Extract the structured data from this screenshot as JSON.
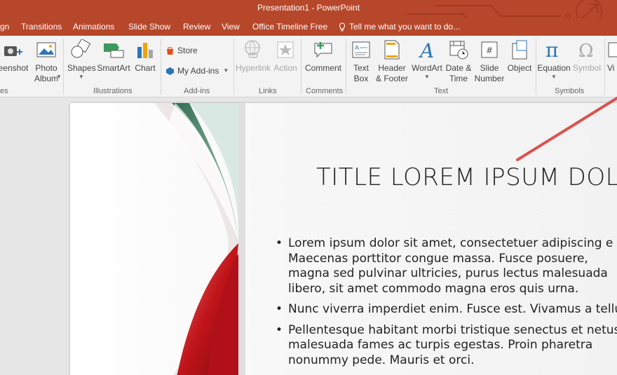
{
  "app": {
    "window_title": "Presentation1 - PowerPoint"
  },
  "tabs": [
    {
      "label": "gn"
    },
    {
      "label": "Transitions"
    },
    {
      "label": "Animations"
    },
    {
      "label": "Slide Show"
    },
    {
      "label": "Review"
    },
    {
      "label": "View"
    },
    {
      "label": "Office Timeline Free"
    }
  ],
  "tell_me": {
    "text": "Tell me what you want to do..."
  },
  "ribbon": {
    "images": {
      "screenshot": "eenshot",
      "photo_album": "Photo\nAlbum",
      "label": "es"
    },
    "illustrations": {
      "shapes": "Shapes",
      "smartart": "SmartArt",
      "chart": "Chart",
      "label": "Illustrations"
    },
    "addins": {
      "store": "Store",
      "my_addins": "My Add-ins",
      "label": "Add-ins"
    },
    "links": {
      "hyperlink": "Hyperlink",
      "action": "Action",
      "label": "Links"
    },
    "comments": {
      "comment": "Comment",
      "label": "Comments"
    },
    "text": {
      "text_box": "Text\nBox",
      "header_footer": "Header\n& Footer",
      "wordart": "WordArt",
      "date_time": "Date &\nTime",
      "slide_number": "Slide\nNumber",
      "object": "Object",
      "label": "Text"
    },
    "symbols": {
      "equation": "Equation",
      "symbol": "Symbol",
      "label": "Symbols"
    },
    "media": {
      "video": "Vi"
    }
  },
  "slide": {
    "title": "TITLE LOREM IPSUM DOLO",
    "bullets": [
      {
        "lines": [
          "Lorem ipsum dolor sit amet, consectetuer adipiscing e",
          "Maecenas porttitor congue massa. Fusce posuere,",
          "magna sed pulvinar ultricies, purus lectus malesuada",
          "libero, sit amet commodo magna eros quis urna."
        ]
      },
      {
        "lines": [
          "Nunc viverra imperdiet enim. Fusce est. Vivamus a tellu"
        ]
      },
      {
        "lines": [
          "Pellentesque habitant morbi tristique senectus et netus",
          "malesuada fames ac turpis egestas. Proin pharetra",
          "nonummy pede. Mauris et orci."
        ]
      }
    ]
  },
  "colors": {
    "accent": "#b7472a",
    "ribbon_bg": "#f3f3f3",
    "arrow": "#d9534f"
  },
  "icons": [
    "screenshot-icon",
    "photo-album-icon",
    "shapes-icon",
    "smartart-icon",
    "chart-icon",
    "store-icon",
    "my-addins-icon",
    "hyperlink-icon",
    "action-icon",
    "comment-icon",
    "text-box-icon",
    "header-footer-icon",
    "wordart-icon",
    "date-time-icon",
    "slide-number-icon",
    "object-icon",
    "equation-icon",
    "symbol-icon",
    "lightbulb-icon"
  ]
}
